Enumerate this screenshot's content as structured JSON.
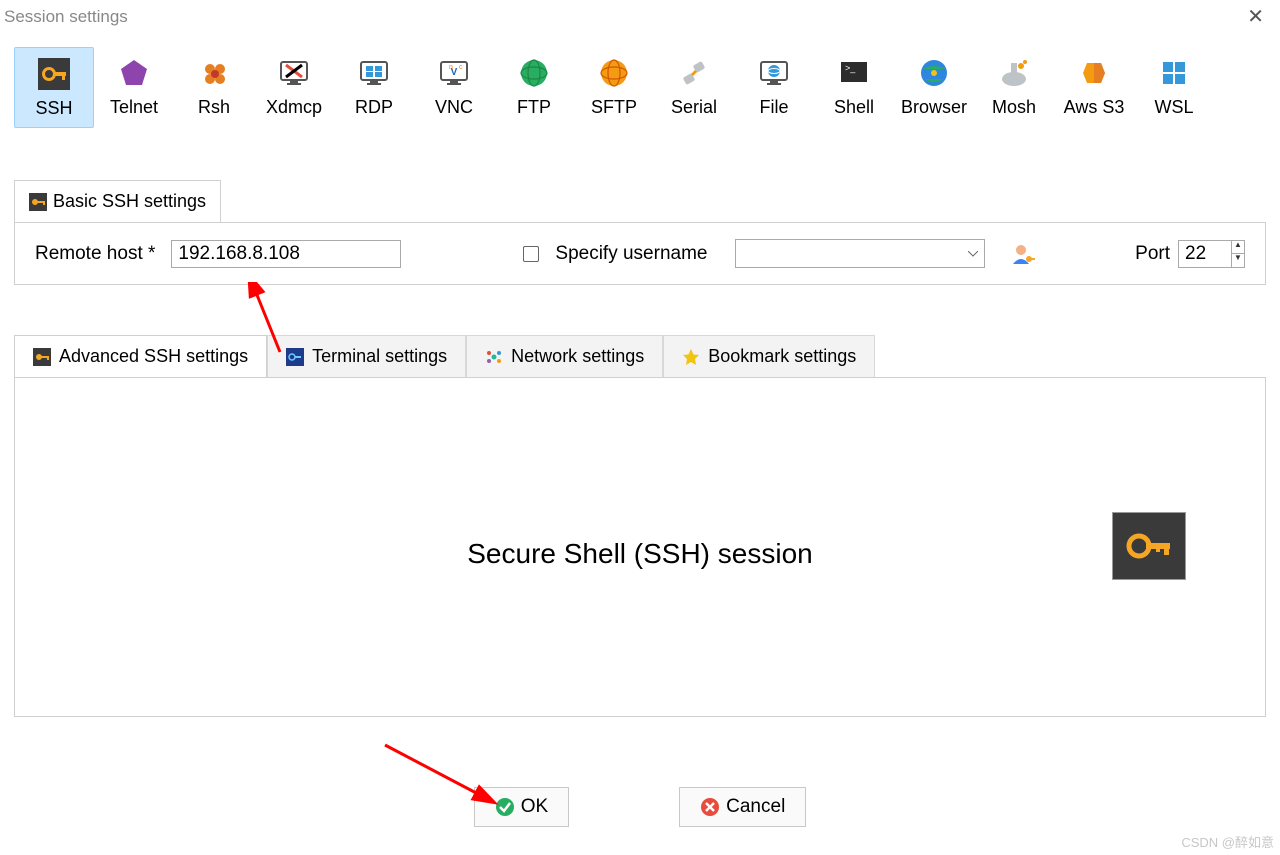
{
  "window": {
    "title": "Session settings"
  },
  "types": [
    {
      "id": "ssh",
      "label": "SSH",
      "selected": true
    },
    {
      "id": "telnet",
      "label": "Telnet",
      "selected": false
    },
    {
      "id": "rsh",
      "label": "Rsh",
      "selected": false
    },
    {
      "id": "xdmcp",
      "label": "Xdmcp",
      "selected": false
    },
    {
      "id": "rdp",
      "label": "RDP",
      "selected": false
    },
    {
      "id": "vnc",
      "label": "VNC",
      "selected": false
    },
    {
      "id": "ftp",
      "label": "FTP",
      "selected": false
    },
    {
      "id": "sftp",
      "label": "SFTP",
      "selected": false
    },
    {
      "id": "serial",
      "label": "Serial",
      "selected": false
    },
    {
      "id": "file",
      "label": "File",
      "selected": false
    },
    {
      "id": "shell",
      "label": "Shell",
      "selected": false
    },
    {
      "id": "browser",
      "label": "Browser",
      "selected": false
    },
    {
      "id": "mosh",
      "label": "Mosh",
      "selected": false
    },
    {
      "id": "awss3",
      "label": "Aws S3",
      "selected": false
    },
    {
      "id": "wsl",
      "label": "WSL",
      "selected": false
    }
  ],
  "basic": {
    "tab_label": "Basic SSH settings",
    "remote_host_label": "Remote host *",
    "remote_host_value": "192.168.8.108",
    "specify_username_label": "Specify username",
    "specify_username_checked": false,
    "username_value": "",
    "port_label": "Port",
    "port_value": "22"
  },
  "adv_tabs": [
    {
      "id": "adv-ssh",
      "label": "Advanced SSH settings"
    },
    {
      "id": "terminal",
      "label": "Terminal settings"
    },
    {
      "id": "network",
      "label": "Network settings"
    },
    {
      "id": "bookmark",
      "label": "Bookmark settings"
    }
  ],
  "adv_panel": {
    "title": "Secure Shell (SSH) session"
  },
  "footer": {
    "ok": "OK",
    "cancel": "Cancel"
  },
  "watermark": "CSDN @醉如意"
}
